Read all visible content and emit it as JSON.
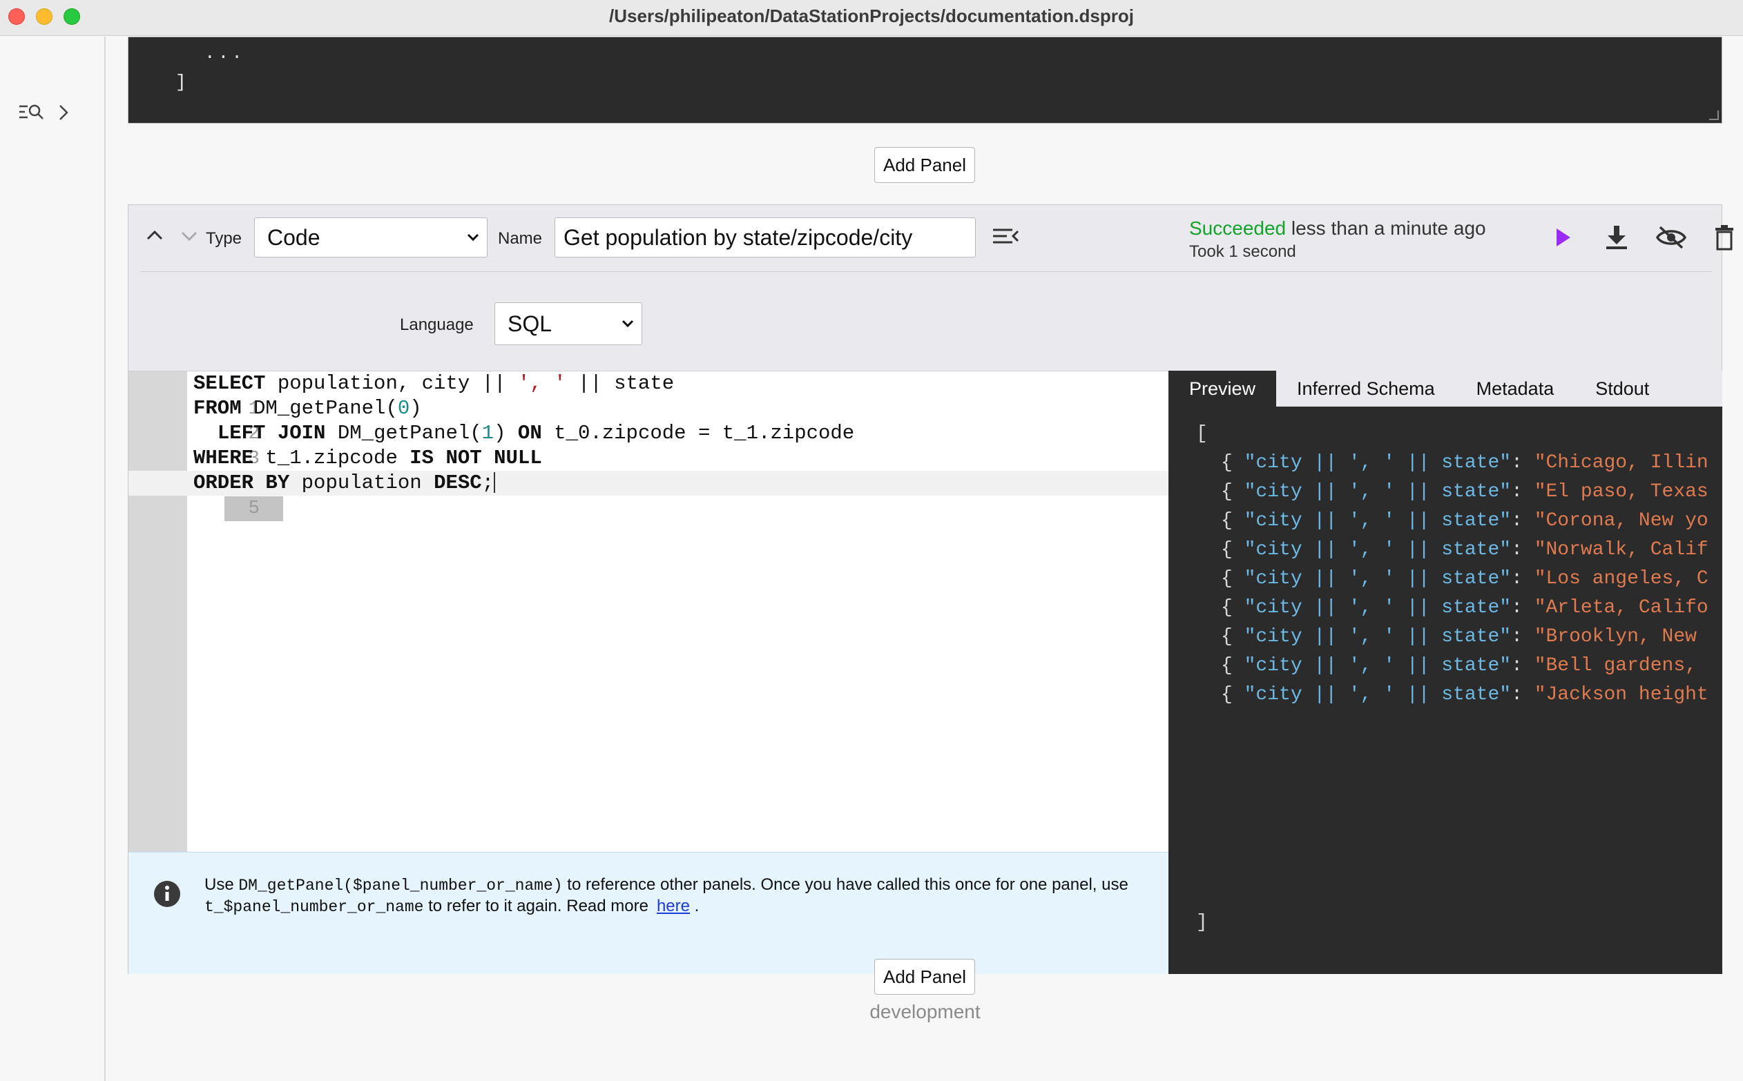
{
  "window": {
    "title": "/Users/philipeaton/DataStationProjects/documentation.dsproj"
  },
  "previous_panel": {
    "lines": [
      "...",
      "]"
    ]
  },
  "add_panel_label": "Add Panel",
  "panel": {
    "type_label": "Type",
    "type_value": "Code",
    "name_label": "Name",
    "name_value": "Get population by state/zipcode/city",
    "status": {
      "ok": "Succeeded",
      "when": " less than a minute ago",
      "duration": "Took 1 second"
    },
    "language_label": "Language",
    "language_value": "SQL",
    "code_lines": [
      "SELECT population, city || ', ' || state",
      "FROM DM_getPanel(0)",
      "  LEFT JOIN DM_getPanel(1) ON t_0.zipcode = t_1.zipcode",
      "WHERE t_1.zipcode IS NOT NULL",
      "ORDER BY population DESC;"
    ],
    "line_numbers": [
      "1",
      "2",
      "3",
      "4",
      "5"
    ],
    "info": {
      "use": "Use ",
      "fn": "DM_getPanel($panel_number_or_name)",
      "mid": " to reference other panels. Once you have called this once for one panel, use ",
      "var": "t_$panel_number_or_name",
      "tail": " to refer to it again. Read more",
      "link": "here",
      "end": "."
    },
    "tabs": [
      "Preview",
      "Inferred Schema",
      "Metadata",
      "Stdout"
    ],
    "active_tab": "Preview",
    "preview": {
      "open": "[",
      "close": "]",
      "key": "\"city || ', ' || state\"",
      "values": [
        "\"Chicago, Illin",
        "\"El paso, Texas",
        "\"Corona, New yo",
        "\"Norwalk, Calif",
        "\"Los angeles, C",
        "\"Arleta, Califo",
        "\"Brooklyn, New ",
        "\"Bell gardens, ",
        "\"Jackson height"
      ]
    }
  },
  "footer": "development",
  "colors": {
    "success": "#13a32b",
    "run": "#9b2bf5",
    "json_key": "#6cb9e6",
    "json_value": "#e07a4f"
  },
  "icons": [
    "sidebar-search-icon",
    "chevron-right-icon",
    "chevron-up-icon",
    "chevron-down-icon",
    "collapse-icon",
    "play-icon",
    "download-icon",
    "eye-off-icon",
    "trash-icon",
    "info-icon"
  ]
}
